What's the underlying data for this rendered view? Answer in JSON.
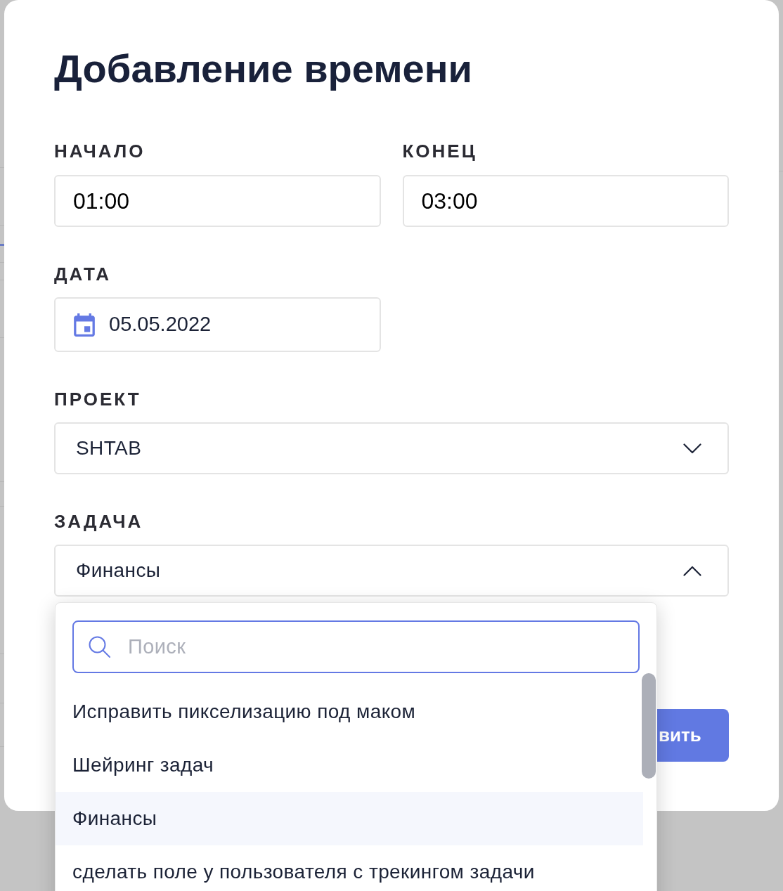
{
  "dialog": {
    "title": "Добавление времени"
  },
  "start": {
    "label": "НАЧАЛО",
    "value": "01:00"
  },
  "end": {
    "label": "КОНЕЦ",
    "value": "03:00"
  },
  "date": {
    "label": "ДАТА",
    "value": "05.05.2022"
  },
  "project": {
    "label": "ПРОЕКТ",
    "value": "SHTAB",
    "expanded": false
  },
  "task": {
    "label": "ЗАДАЧА",
    "value": "Финансы",
    "expanded": true,
    "dropdown": {
      "search": {
        "placeholder": "Поиск"
      },
      "options": [
        {
          "label": "Исправить пикселизацию под маком",
          "selected": false
        },
        {
          "label": "Шейринг задач",
          "selected": false
        },
        {
          "label": "Финансы",
          "selected": true
        },
        {
          "label": "сделать поле у пользователя с трекингом задачи",
          "selected": false
        }
      ]
    }
  },
  "submit_button": {
    "label": "вить"
  }
}
